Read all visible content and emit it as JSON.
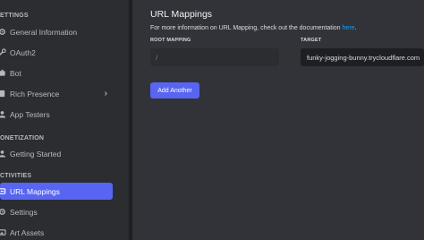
{
  "sidebar": {
    "sections": [
      {
        "label": "ETTINGS"
      },
      {
        "label": "ONETIZATION"
      },
      {
        "label": "CTIVITIES"
      }
    ],
    "items": [
      {
        "label": "General Information",
        "icon": "gear-icon"
      },
      {
        "label": "OAuth2",
        "icon": "wrench-icon"
      },
      {
        "label": "Bot",
        "icon": "puzzle-icon"
      },
      {
        "label": "Rich Presence",
        "icon": "document-icon",
        "chevron": "›"
      },
      {
        "label": "App Testers",
        "icon": "people-icon"
      },
      {
        "label": "Getting Started",
        "icon": "people-icon"
      },
      {
        "label": "URL Mappings",
        "icon": "link-icon",
        "active": true
      },
      {
        "label": "Settings",
        "icon": "gear-icon"
      },
      {
        "label": "Art Assets",
        "icon": "image-icon"
      }
    ]
  },
  "main": {
    "title": "URL Mappings",
    "description": "For more information on URL Mapping, check out the documentation ",
    "description_link": "here",
    "description_end": ".",
    "root_mapping_label": "ROOT MAPPING",
    "target_label": "TARGET",
    "root_mapping_value": "/",
    "target_value": "funky-jogging-bunny.trycloudflare.com",
    "add_button": "Add Another"
  },
  "colors": {
    "accent": "#5865f2",
    "link": "#00a8fc",
    "sidebar_bg": "#2b2d31",
    "main_bg": "#313338"
  }
}
